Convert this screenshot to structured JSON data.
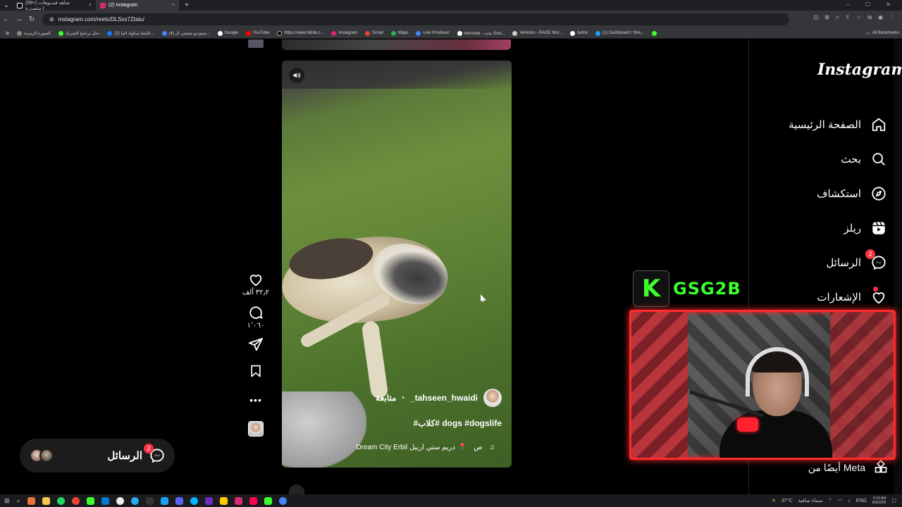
{
  "browser": {
    "tabs": [
      {
        "title": "(99+) شاهد فيديوهات متصدرة |",
        "color": "#ffffff"
      },
      {
        "title": "(2) Instagram",
        "color": "#d62976"
      }
    ],
    "url": "instagram.com/reels/DLSxs7Ztaiu/",
    "bookmarks": [
      "الصورة الرمزية",
      "دخل برنامج الشريك",
      "(2) الباشا سكواد اليبا...",
      "(4) ستوديو منشئي ال...",
      "Google",
      "YouTube",
      "https://www.tiktok.c...",
      "Instagram",
      "Gmail",
      "Maps",
      "Live Producer",
      "wormate - بحث Goo...",
      "Vehicles - RAGE Mul...",
      "botrix",
      "(1) Dashboard / Stre..."
    ],
    "all_bookmarks": "All Bookmarks"
  },
  "reel": {
    "author": "tahseen_hwaidi_",
    "separator": "•",
    "follow_label": "متابعة",
    "caption": "dogs #dogslife #كلاب#",
    "location": "دريم ستي اربيل Dream City Erbil",
    "audio_label": "ص",
    "likes": "٣٢٫٢ ألف",
    "comments": "١٬٠٦٠",
    "more_icon": "•••"
  },
  "sidebar": {
    "logo": "Instagram",
    "items": [
      {
        "label": "الصفحة الرئيسية",
        "icon": "home-icon"
      },
      {
        "label": "بحث",
        "icon": "search-icon"
      },
      {
        "label": "استكشاف",
        "icon": "explore-icon"
      },
      {
        "label": "ريلز",
        "icon": "reels-icon"
      },
      {
        "label": "الرسائل",
        "icon": "messenger-icon",
        "badge": "2"
      },
      {
        "label": "الإشعارات",
        "icon": "heart-icon"
      }
    ],
    "also_from_meta": "أيضًا من Meta"
  },
  "messages_pill": {
    "label": "الرسائل",
    "badge": "2"
  },
  "overlay": {
    "brand_letter": "K",
    "brand_text": "GSG2B",
    "accent": "#3cff2e",
    "frame_color": "#ff2a2a"
  },
  "taskbar": {
    "weather": "37°C",
    "weather_desc": "سماء صافية",
    "lang": "ENG",
    "time": "6:20 AM",
    "date": "8/9/2025"
  }
}
